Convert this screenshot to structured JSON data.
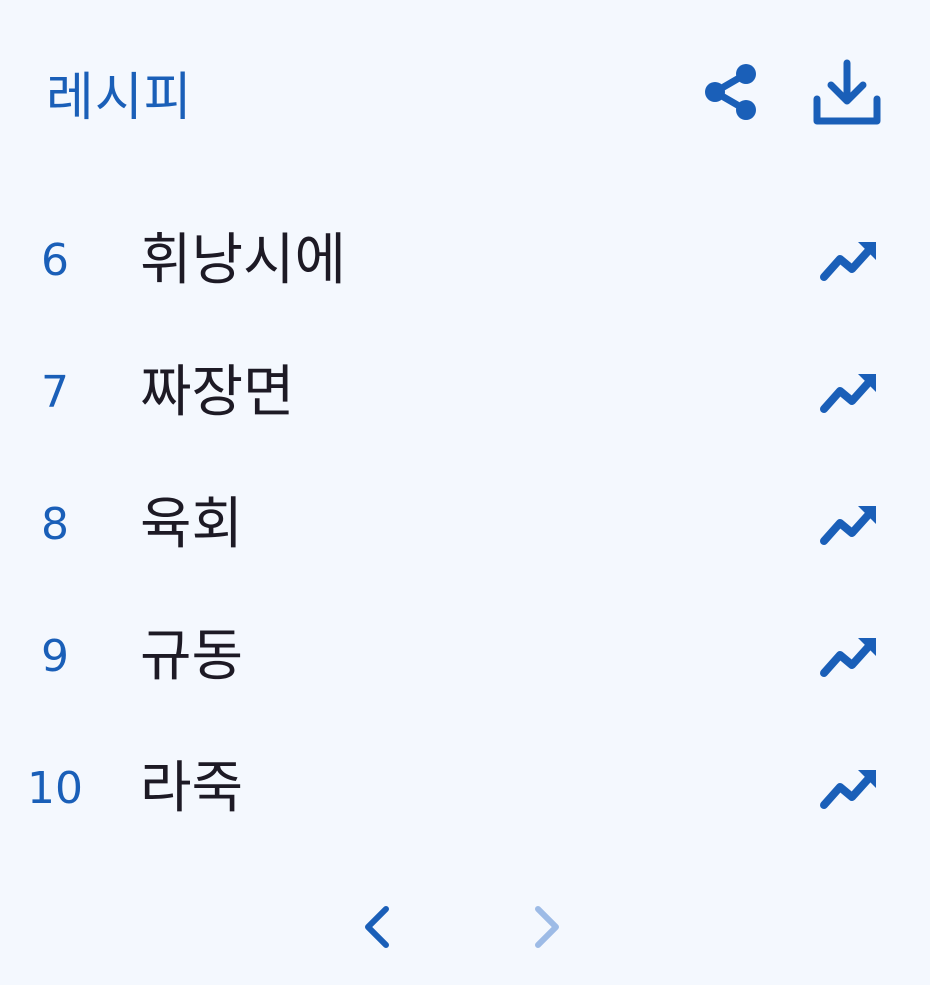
{
  "header": {
    "title": "레시피",
    "share_icon": "share-icon",
    "download_icon": "download-icon"
  },
  "ranking": {
    "items": [
      {
        "rank": "6",
        "name": "휘낭시에",
        "trend_icon": "trending-up-icon"
      },
      {
        "rank": "7",
        "name": "짜장면",
        "trend_icon": "trending-up-icon"
      },
      {
        "rank": "8",
        "name": "육회",
        "trend_icon": "trending-up-icon"
      },
      {
        "rank": "9",
        "name": "규동",
        "trend_icon": "trending-up-icon"
      },
      {
        "rank": "10",
        "name": "라죽",
        "trend_icon": "trending-up-icon"
      }
    ]
  },
  "pagination": {
    "prev_icon": "chevron-left-icon",
    "next_icon": "chevron-right-icon",
    "next_disabled": true
  },
  "colors": {
    "accent": "#1a5fb8",
    "text": "#1d1a25",
    "background": "#f4f8fe",
    "disabled": "#9dbbe6"
  }
}
